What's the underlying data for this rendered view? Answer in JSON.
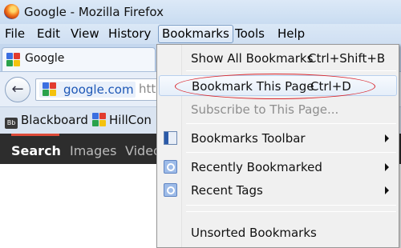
{
  "window": {
    "title": "Google - Mozilla Firefox"
  },
  "menubar": {
    "items": [
      "File",
      "Edit",
      "View",
      "History",
      "Bookmarks",
      "Tools",
      "Help"
    ]
  },
  "tab": {
    "label": "Google"
  },
  "navbar": {
    "domain": "google.com",
    "path_fragment": "htt"
  },
  "bookmarks_toolbar": {
    "items": [
      "Blackboard",
      "HillCon"
    ]
  },
  "google_bar": {
    "links": [
      "Search",
      "Images",
      "Video"
    ]
  },
  "bookmarks_menu": {
    "items": [
      {
        "label": "Show All Bookmarks",
        "shortcut": "Ctrl+Shift+B"
      },
      {
        "label": "Bookmark This Page",
        "shortcut": "Ctrl+D"
      },
      {
        "label": "Subscribe to This Page..."
      },
      {
        "label": "Bookmarks Toolbar"
      },
      {
        "label": "Recently Bookmarked"
      },
      {
        "label": "Recent Tags"
      },
      {
        "label": "Unsorted Bookmarks"
      }
    ]
  },
  "colors": {
    "highlight_ellipse": "#d9242b",
    "google_bar_bg": "#2d2d2d"
  }
}
